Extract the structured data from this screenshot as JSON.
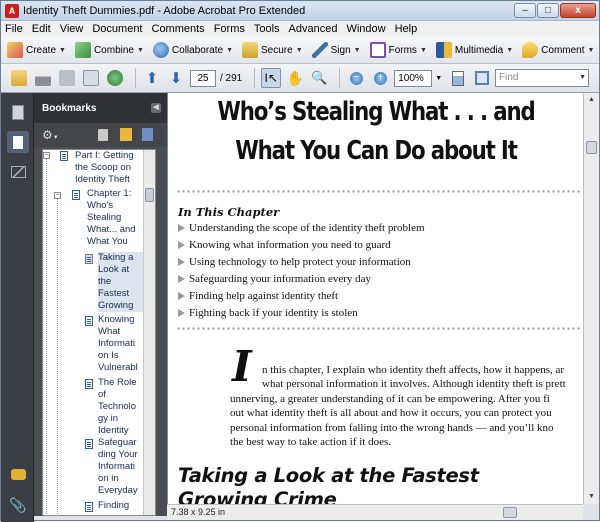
{
  "window": {
    "title": "Identity Theft Dummies.pdf - Adobe Acrobat Pro Extended",
    "app_icon": "A",
    "min": "–",
    "max": "□",
    "close": "x"
  },
  "menu": [
    "File",
    "Edit",
    "View",
    "Document",
    "Comments",
    "Forms",
    "Tools",
    "Advanced",
    "Window",
    "Help"
  ],
  "tasks": [
    {
      "label": "Create",
      "icon": "create-icon",
      "color": "#d9534f"
    },
    {
      "label": "Combine",
      "icon": "combine-icon",
      "color": "#3a8f3a"
    },
    {
      "label": "Collaborate",
      "icon": "collaborate-icon",
      "color": "#2f6fb5"
    },
    {
      "label": "Secure",
      "icon": "lock-icon",
      "color": "#c9a227"
    },
    {
      "label": "Sign",
      "icon": "pen-icon",
      "color": "#3a6fa8"
    },
    {
      "label": "Forms",
      "icon": "forms-icon",
      "color": "#7a4fb3"
    },
    {
      "label": "Multimedia",
      "icon": "multimedia-icon",
      "color": "#2c5aa0"
    },
    {
      "label": "Comment",
      "icon": "comment-icon",
      "color": "#e0a820"
    }
  ],
  "nav": {
    "page": "25",
    "total": "/ 291",
    "zoom": "100%",
    "find_placeholder": "Find"
  },
  "panel": {
    "title": "Bookmarks"
  },
  "bookmarks": [
    {
      "lines": [
        "Part I: Getting",
        "the Scoop on",
        "Identity Theft"
      ]
    },
    {
      "lines": [
        "Chapter 1:",
        "Who's",
        "Stealing",
        "What... and",
        "What You"
      ]
    },
    {
      "lines": [
        "Taking a",
        "Look at",
        "the",
        "Fastest",
        "Growing"
      ]
    },
    {
      "lines": [
        "Knowing",
        "What",
        "Informati",
        "on Is",
        "Vulnerabl"
      ]
    },
    {
      "lines": [
        "The Role",
        "of",
        "Technolo",
        "gy in",
        "Identity"
      ]
    },
    {
      "lines": [
        "Safeguar",
        "ding Your",
        "Informati",
        "on in",
        "Everyday"
      ]
    },
    {
      "lines": [
        "Finding"
      ]
    }
  ],
  "doc": {
    "title_line1": "Who’s Stealing What . . . and",
    "title_line2": "What You Can Do about It",
    "in_this_chapter": "In This Chapter",
    "bullets": [
      "Understanding the scope of the identity theft problem",
      "Knowing what information you need to guard",
      "Using technology to help protect your information",
      "Safeguarding your information every day",
      "Finding help against identity theft",
      "Fighting back if your identity is stolen"
    ],
    "drop_cap": "I",
    "para_lines": [
      "n this chapter, I explain who identity theft affects, how it happens, ar",
      "what personal information it involves. Although identity theft is prett",
      "unnerving, a greater understanding of it can be empowering. After you fi",
      "out what identity theft is all about and how it occurs, you can protect you",
      "personal information from falling into the wrong hands — and you’ll kno",
      "the best way to take action if it does."
    ],
    "section_heading_1": "Taking a Look at the Fastest",
    "section_heading_2": "Growing Crime"
  },
  "status": {
    "page_size": "7.38 x 9.25 in"
  }
}
